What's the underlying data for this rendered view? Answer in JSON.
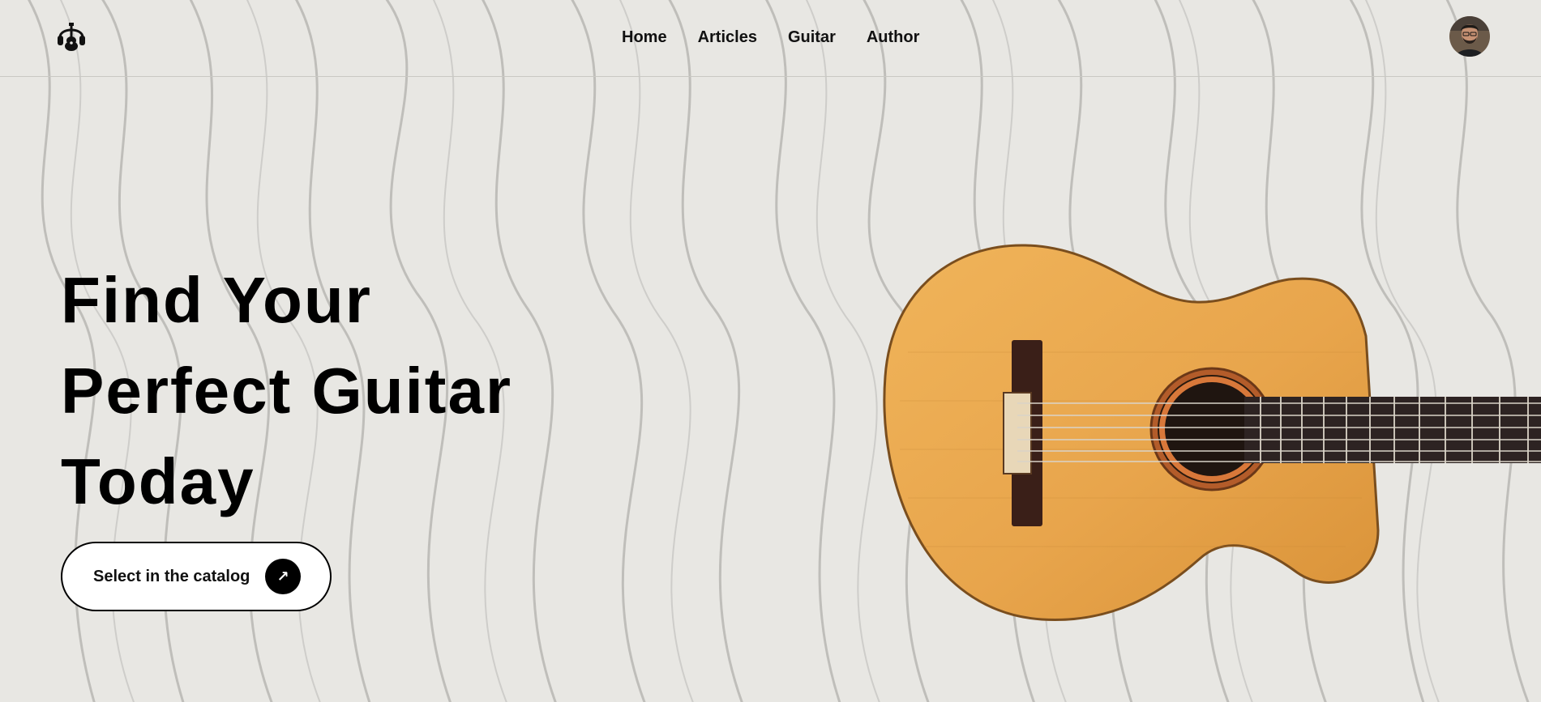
{
  "header": {
    "logo_icon": "guitar-headphones-logo-icon",
    "nav": [
      {
        "label": "Home"
      },
      {
        "label": "Articles"
      },
      {
        "label": "Guitar"
      },
      {
        "label": "Author"
      }
    ],
    "avatar_icon": "user-avatar-icon"
  },
  "hero": {
    "title_lines": [
      "Find Your",
      "Perfect Guitar",
      "Today"
    ],
    "cta_label": "Select in the catalog",
    "cta_icon": "arrow-up-right-icon",
    "cta_glyph": "↗",
    "image": "classical-guitar-image"
  },
  "colors": {
    "background": "#e8e7e3",
    "text": "#000000",
    "guitar_body": "#e9a84f",
    "button_bg": "#ffffff",
    "button_icon_bg": "#000000"
  }
}
